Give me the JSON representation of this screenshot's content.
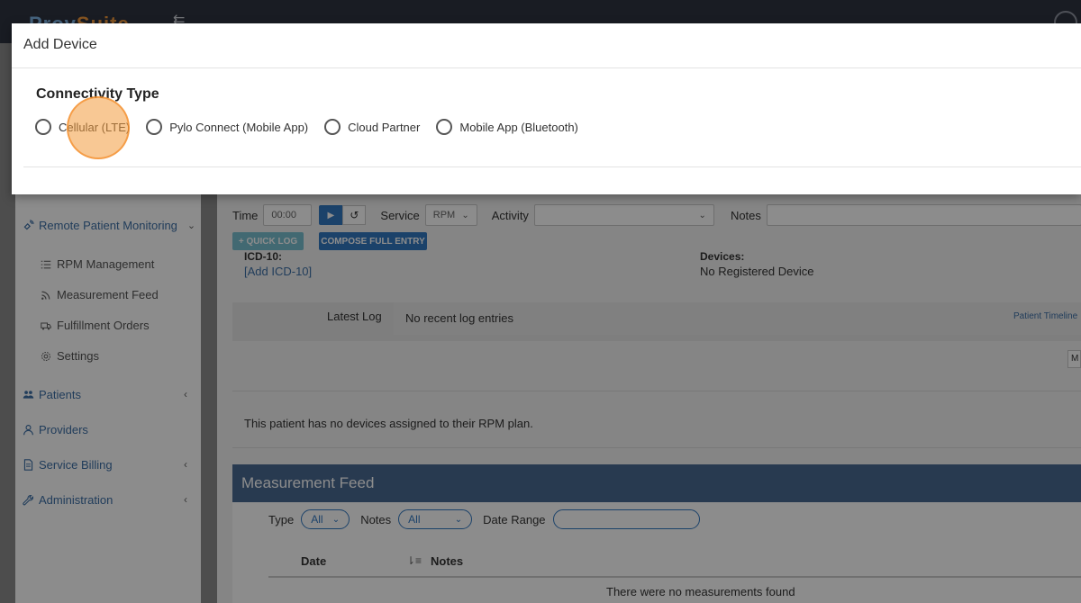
{
  "app": {
    "logo_primary": "Prov",
    "logo_accent": "Suite",
    "collapse_icon": "collapse-menu-icon",
    "user_icon": "user-icon"
  },
  "sidebar": {
    "rpm_label": "Remote Patient Monitoring",
    "rpm_items": [
      "RPM Management",
      "Measurement Feed",
      "Fulfillment Orders",
      "Settings"
    ],
    "items": [
      "Patients",
      "Providers",
      "Service Billing",
      "Administration"
    ]
  },
  "toolbar": {
    "time_label": "Time",
    "time_value": "00:00",
    "service_label": "Service",
    "service_value": "RPM",
    "activity_label": "Activity",
    "activity_value": "",
    "notes_label": "Notes",
    "notes_value": "",
    "quick_log": "+ QUICK LOG",
    "compose": "COMPOSE FULL ENTRY"
  },
  "patient": {
    "icd_label": "ICD-10:",
    "icd_link": "[Add ICD-10]",
    "devices_label": "Devices:",
    "devices_value": "No Registered Device",
    "latest_log_label": "Latest Log",
    "latest_log_value": "No recent log entries",
    "timeline_link": "Patient Timeline",
    "more_btn": "M",
    "no_devices": "This patient has no devices assigned to their RPM plan."
  },
  "measurement_feed": {
    "title": "Measurement Feed",
    "type_label": "Type",
    "type_value": "All",
    "notes_label": "Notes",
    "notes_value": "All",
    "date_range_label": "Date Range",
    "date_range_value": "",
    "col_date": "Date",
    "col_notes": "Notes",
    "empty": "There were no measurements found"
  },
  "modal": {
    "title": "Add Device",
    "section_label": "Connectivity Type",
    "options": [
      "Cellular (LTE)",
      "Pylo Connect (Mobile App)",
      "Cloud Partner",
      "Mobile App (Bluetooth)"
    ]
  }
}
